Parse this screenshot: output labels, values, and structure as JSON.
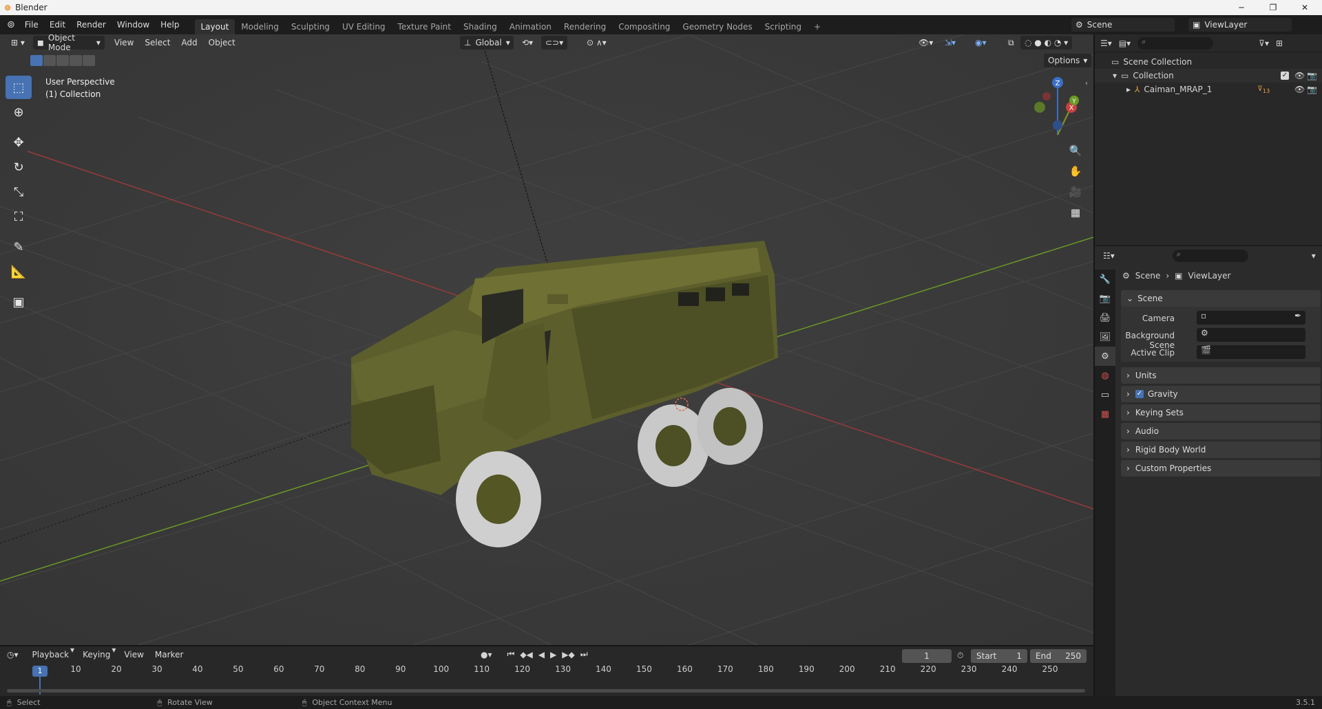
{
  "window": {
    "title": "Blender",
    "minimize": "─",
    "maximize": "❐",
    "close": "✕"
  },
  "menus": [
    "File",
    "Edit",
    "Render",
    "Window",
    "Help"
  ],
  "workspaces": [
    "Layout",
    "Modeling",
    "Sculpting",
    "UV Editing",
    "Texture Paint",
    "Shading",
    "Animation",
    "Rendering",
    "Compositing",
    "Geometry Nodes",
    "Scripting"
  ],
  "workspace_add": "+",
  "scene_field": "Scene",
  "viewlayer_field": "ViewLayer",
  "viewport": {
    "mode": "Object Mode",
    "menu": [
      "View",
      "Select",
      "Add",
      "Object"
    ],
    "orientation": "Global",
    "options": "Options",
    "overlay_line1": "User Perspective",
    "overlay_line2": "(1) Collection",
    "axes": {
      "x": "X",
      "y": "Y",
      "z": "Z"
    }
  },
  "outliner": {
    "scene_collection": "Scene Collection",
    "collection": "Collection",
    "object": "Caiman_MRAP_1",
    "object_count": "13"
  },
  "properties": {
    "breadcrumb_scene": "Scene",
    "breadcrumb_viewlayer": "ViewLayer",
    "panel_title": "Scene",
    "camera_label": "Camera",
    "background_scene_label": "Background Scene",
    "active_clip_label": "Active Clip",
    "panels": [
      "Units",
      "Gravity",
      "Keying Sets",
      "Audio",
      "Rigid Body World",
      "Custom Properties"
    ]
  },
  "timeline": {
    "menu": [
      "Playback",
      "Keying",
      "View",
      "Marker"
    ],
    "current_frame": "1",
    "start_label": "Start",
    "start_value": "1",
    "end_label": "End",
    "end_value": "250",
    "ticks": [
      "1",
      "10",
      "20",
      "30",
      "40",
      "50",
      "60",
      "70",
      "80",
      "90",
      "100",
      "110",
      "120",
      "130",
      "140",
      "150",
      "160",
      "170",
      "180",
      "190",
      "200",
      "210",
      "220",
      "230",
      "240",
      "250"
    ]
  },
  "statusbar": {
    "select": "Select",
    "rotate": "Rotate View",
    "context": "Object Context Menu",
    "version": "3.5.1"
  },
  "colors": {
    "accent": "#4772b3",
    "vehicle": "#5c5e2c",
    "tire": "#cfcfcf",
    "x_axis": "#a83a3a",
    "y_axis": "#6a9a25"
  }
}
